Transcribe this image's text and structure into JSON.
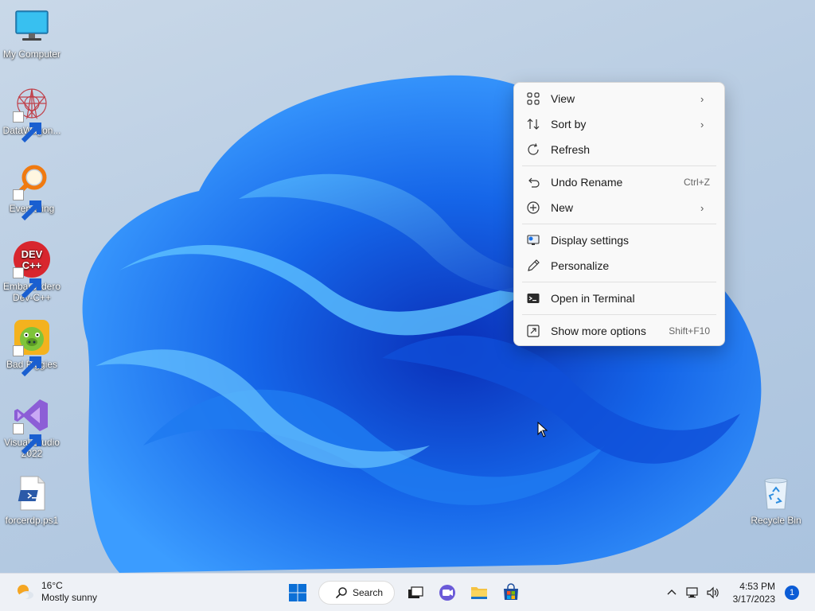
{
  "desktop": {
    "icons": [
      {
        "label": "My Computer",
        "icon": "monitor-icon"
      },
      {
        "label": "DataWagon...",
        "icon": "datawagon-icon"
      },
      {
        "label": "Everything",
        "icon": "everything-search-icon"
      },
      {
        "label": "Embarcadero Dev-C++",
        "icon": "devcpp-icon",
        "badge": "DEV C++"
      },
      {
        "label": "Bad Piggies",
        "icon": "bad-piggies-icon"
      },
      {
        "label": "Visual Studio 2022",
        "icon": "visual-studio-icon"
      },
      {
        "label": "forcerdp.ps1",
        "icon": "powershell-script-icon"
      },
      {
        "label": "Recycle Bin",
        "icon": "recycle-bin-icon"
      }
    ]
  },
  "context_menu": {
    "items": [
      {
        "label": "View",
        "icon": "grid-view-icon",
        "has_submenu": true
      },
      {
        "label": "Sort by",
        "icon": "sort-icon",
        "has_submenu": true
      },
      {
        "label": "Refresh",
        "icon": "refresh-icon"
      },
      {
        "label": "Undo Rename",
        "icon": "undo-icon",
        "shortcut": "Ctrl+Z"
      },
      {
        "label": "New",
        "icon": "new-plus-icon",
        "has_submenu": true
      },
      {
        "label": "Display settings",
        "icon": "display-settings-icon"
      },
      {
        "label": "Personalize",
        "icon": "pen-icon"
      },
      {
        "label": "Open in Terminal",
        "icon": "terminal-icon"
      },
      {
        "label": "Show more options",
        "icon": "more-options-icon",
        "shortcut": "Shift+F10"
      }
    ]
  },
  "taskbar": {
    "weather": {
      "temp": "16°C",
      "condition": "Mostly sunny"
    },
    "search_label": "Search",
    "clock": {
      "time": "4:53 PM",
      "date": "3/17/2023"
    },
    "notification_count": "1"
  },
  "colors": {
    "accent": "#0b5cd6",
    "taskbar": "#eef1f6",
    "menu": "#f9f9f9"
  }
}
